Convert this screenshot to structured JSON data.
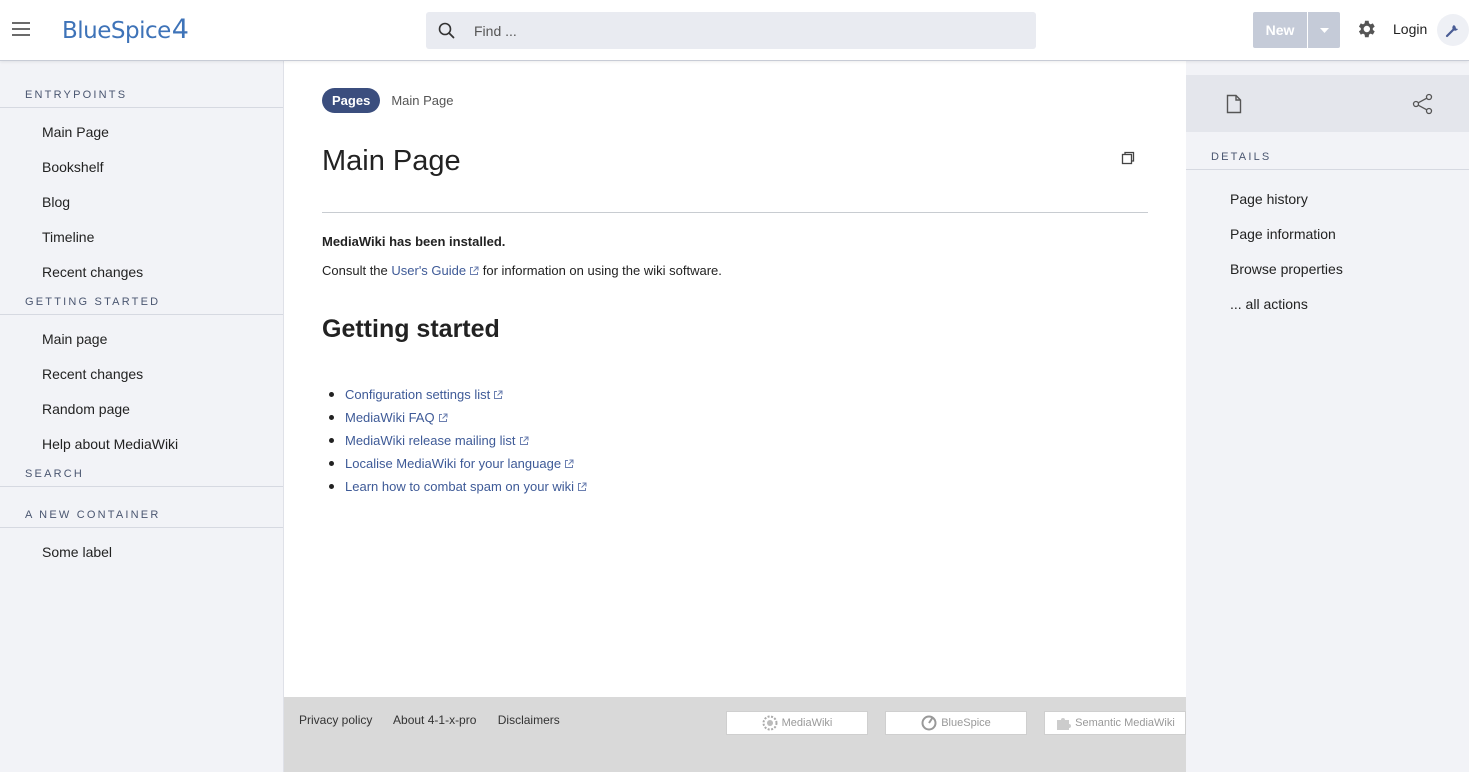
{
  "header": {
    "logo_text": "BlueSpice",
    "logo_number": "4",
    "search_placeholder": "Find ...",
    "new_label": "New",
    "login_label": "Login"
  },
  "left_sidebar": {
    "sections": [
      {
        "title": "ENTRYPOINTS",
        "items": [
          "Main Page",
          "Bookshelf",
          "Blog",
          "Timeline",
          "Recent changes"
        ]
      },
      {
        "title": "GETTING STARTED",
        "items": [
          "Main page",
          "Recent changes",
          "Random page",
          "Help about MediaWiki"
        ]
      },
      {
        "title": "SEARCH",
        "items": []
      },
      {
        "title": "A NEW CONTAINER",
        "items": [
          "Some label"
        ]
      }
    ]
  },
  "main": {
    "breadcrumb_pill": "Pages",
    "breadcrumb_current": "Main Page",
    "title": "Main Page",
    "installed_text": "MediaWiki has been installed.",
    "consult_prefix": "Consult the ",
    "users_guide_link": "User's Guide",
    "consult_suffix": " for information on using the wiki software.",
    "getting_started_heading": "Getting started",
    "links": [
      "Configuration settings list",
      "MediaWiki FAQ",
      "MediaWiki release mailing list",
      "Localise MediaWiki for your language",
      "Learn how to combat spam on your wiki"
    ]
  },
  "footer": {
    "links": [
      "Privacy policy",
      "About 4-1-x-pro",
      "Disclaimers"
    ],
    "badges": [
      "MediaWiki",
      "BlueSpice",
      "Semantic MediaWiki"
    ]
  },
  "right_sidebar": {
    "details_title": "DETAILS",
    "items": [
      "Page history",
      "Page information",
      "Browse properties",
      "... all actions"
    ]
  },
  "colors": {
    "accent": "#3b4e7e",
    "link": "#3e5a97",
    "logo": "#3e73b8",
    "sidebar_bg": "#f2f3f7"
  }
}
